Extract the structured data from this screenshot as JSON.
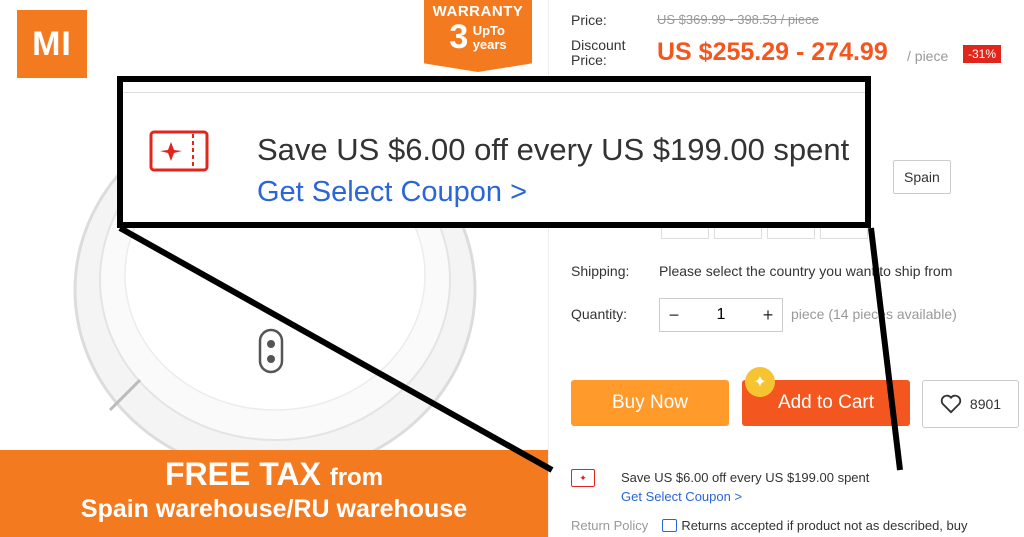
{
  "product_image": {
    "brand_logo_text": "MI",
    "warranty_badge": {
      "line1": "WARRANTY",
      "number": "3",
      "up_to": "UpTo",
      "years": "years"
    },
    "banner": {
      "line1_big": "FREE TAX",
      "line1_small": "from",
      "line2": "Spain warehouse/RU warehouse"
    }
  },
  "price": {
    "label": "Price:",
    "original": "US $369.99 - 398.53 / piece",
    "discount_label_line1": "Discount",
    "discount_label_line2": "Price:",
    "discounted": "US $255.29 - 274.99",
    "unit": "/ piece",
    "discount_badge": "-31%"
  },
  "ships_from": {
    "selected_option": "Spain"
  },
  "shipping": {
    "label": "Shipping:",
    "value": "Please select the country you want to ship from"
  },
  "quantity": {
    "label": "Quantity:",
    "decrement": "−",
    "value": "1",
    "increment": "+",
    "availability": "piece (14 pieces available)"
  },
  "actions": {
    "buy_now": "Buy Now",
    "add_to_cart": "Add to Cart",
    "wishlist_count": "8901"
  },
  "coupon": {
    "text": "Save US $6.00 off every US $199.00 spent",
    "link": "Get Select Coupon >"
  },
  "return_policy": {
    "label": "Return Policy",
    "text": "Returns accepted if product not as described, buy"
  },
  "colors": {
    "orange": "#f47a20",
    "price_red": "#f3571f",
    "buy_now": "#ff9a2b",
    "link_blue": "#2a66d6"
  }
}
